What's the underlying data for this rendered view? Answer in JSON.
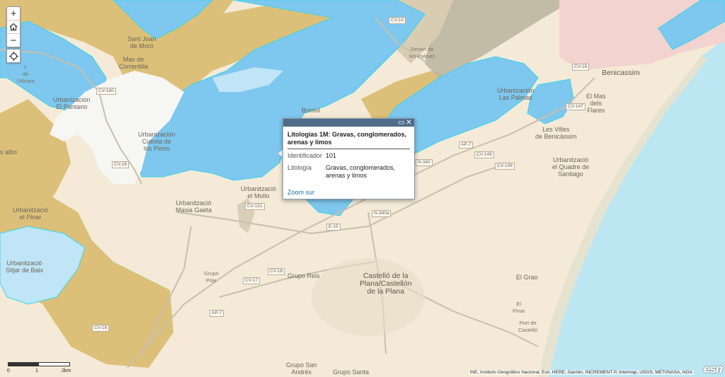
{
  "map": {
    "colors": {
      "base": "#f4ead7",
      "blue": "#7ec7ee",
      "blue_border": "#39d4e8",
      "light_blue": "#bfe5f6",
      "gold": "#dcc07a",
      "pink": "#f2d3d0",
      "grey_gray": "#b8b8ac",
      "sea": "#bde6f3",
      "white_area": "#f6f6f3"
    },
    "places": {
      "sant_joan": "Sant Joan\nde Moró",
      "mas_correntilla": "Mas de\nCorrentilla",
      "urb_el_pantano": "Urbanización\nEl Pantano",
      "urb_cuesta_pinos": "Urbanización\nCuesta de\nlos Pinos",
      "borriol": "Borriol",
      "urb_las_palmas": "Urbanización\nLas Palmas",
      "benicassim": "Benicassim",
      "el_mas_flares": "El Mas\ndels\nFlares",
      "les_villes": "Les Villes\nde Benicàssim",
      "urb_quadre": "Urbanització\nel Quadre de\nSantiago",
      "urb_el_pinar": "Urbanització\nel Pinar",
      "urb_siljar": "Urbanització\nSitjar de Baix",
      "urb_masia": "Urbanització\nMasia Gaeta",
      "urb_el_mollo": "Urbanització\nel Mollo",
      "castello": "Castelló de la\nPlana/Castellón\nde la Plana",
      "grupo_reis": "Grupo Reis",
      "el_grao": "El Grao",
      "grupo_santa": "Grupo Santa",
      "grupo_san_andres": "Grupo San\nAndrés",
      "albo": "s albo",
      "l_lacora": "L\nde\nl'Alcora",
      "desert": "Desert de\nles Palmes",
      "grupo_pilar": "Grupo\nPilar",
      "el_pinar": "El\nPinar",
      "port_grao": "Port de\nCastelló"
    },
    "roads": [
      "CV-16",
      "CV-160",
      "CV-10",
      "CV-149",
      "CV-147",
      "AP-7",
      "N-340",
      "CV-151",
      "CV-17",
      "N-340a",
      "E-15",
      "AP-7",
      "CV-16",
      "CV-16",
      "CV-18",
      "CV-149"
    ]
  },
  "controls": {
    "zoom_in": "+",
    "home_icon": "home-icon",
    "zoom_out": "−",
    "locate_icon": "locate-icon"
  },
  "popup": {
    "title": "Litologías 1M: Gravas, conglomerados, arenas y limos",
    "fields": [
      {
        "key": "Identificador",
        "value": "101"
      },
      {
        "key": "Litología",
        "value": "Gravas, conglomerados, arenas y limos"
      }
    ],
    "zoom_link": "Zoom sur",
    "maximize_icon": "▭",
    "close_icon": "✕"
  },
  "scale": {
    "labels": [
      "0",
      "1",
      "2km"
    ]
  },
  "attribution": "INE, Instituto Geográfico Nacional, Esri, HERE, Garmin, INCREMENT P, Intermap, USGS, METI/NASA, NGA",
  "logo": "esri"
}
